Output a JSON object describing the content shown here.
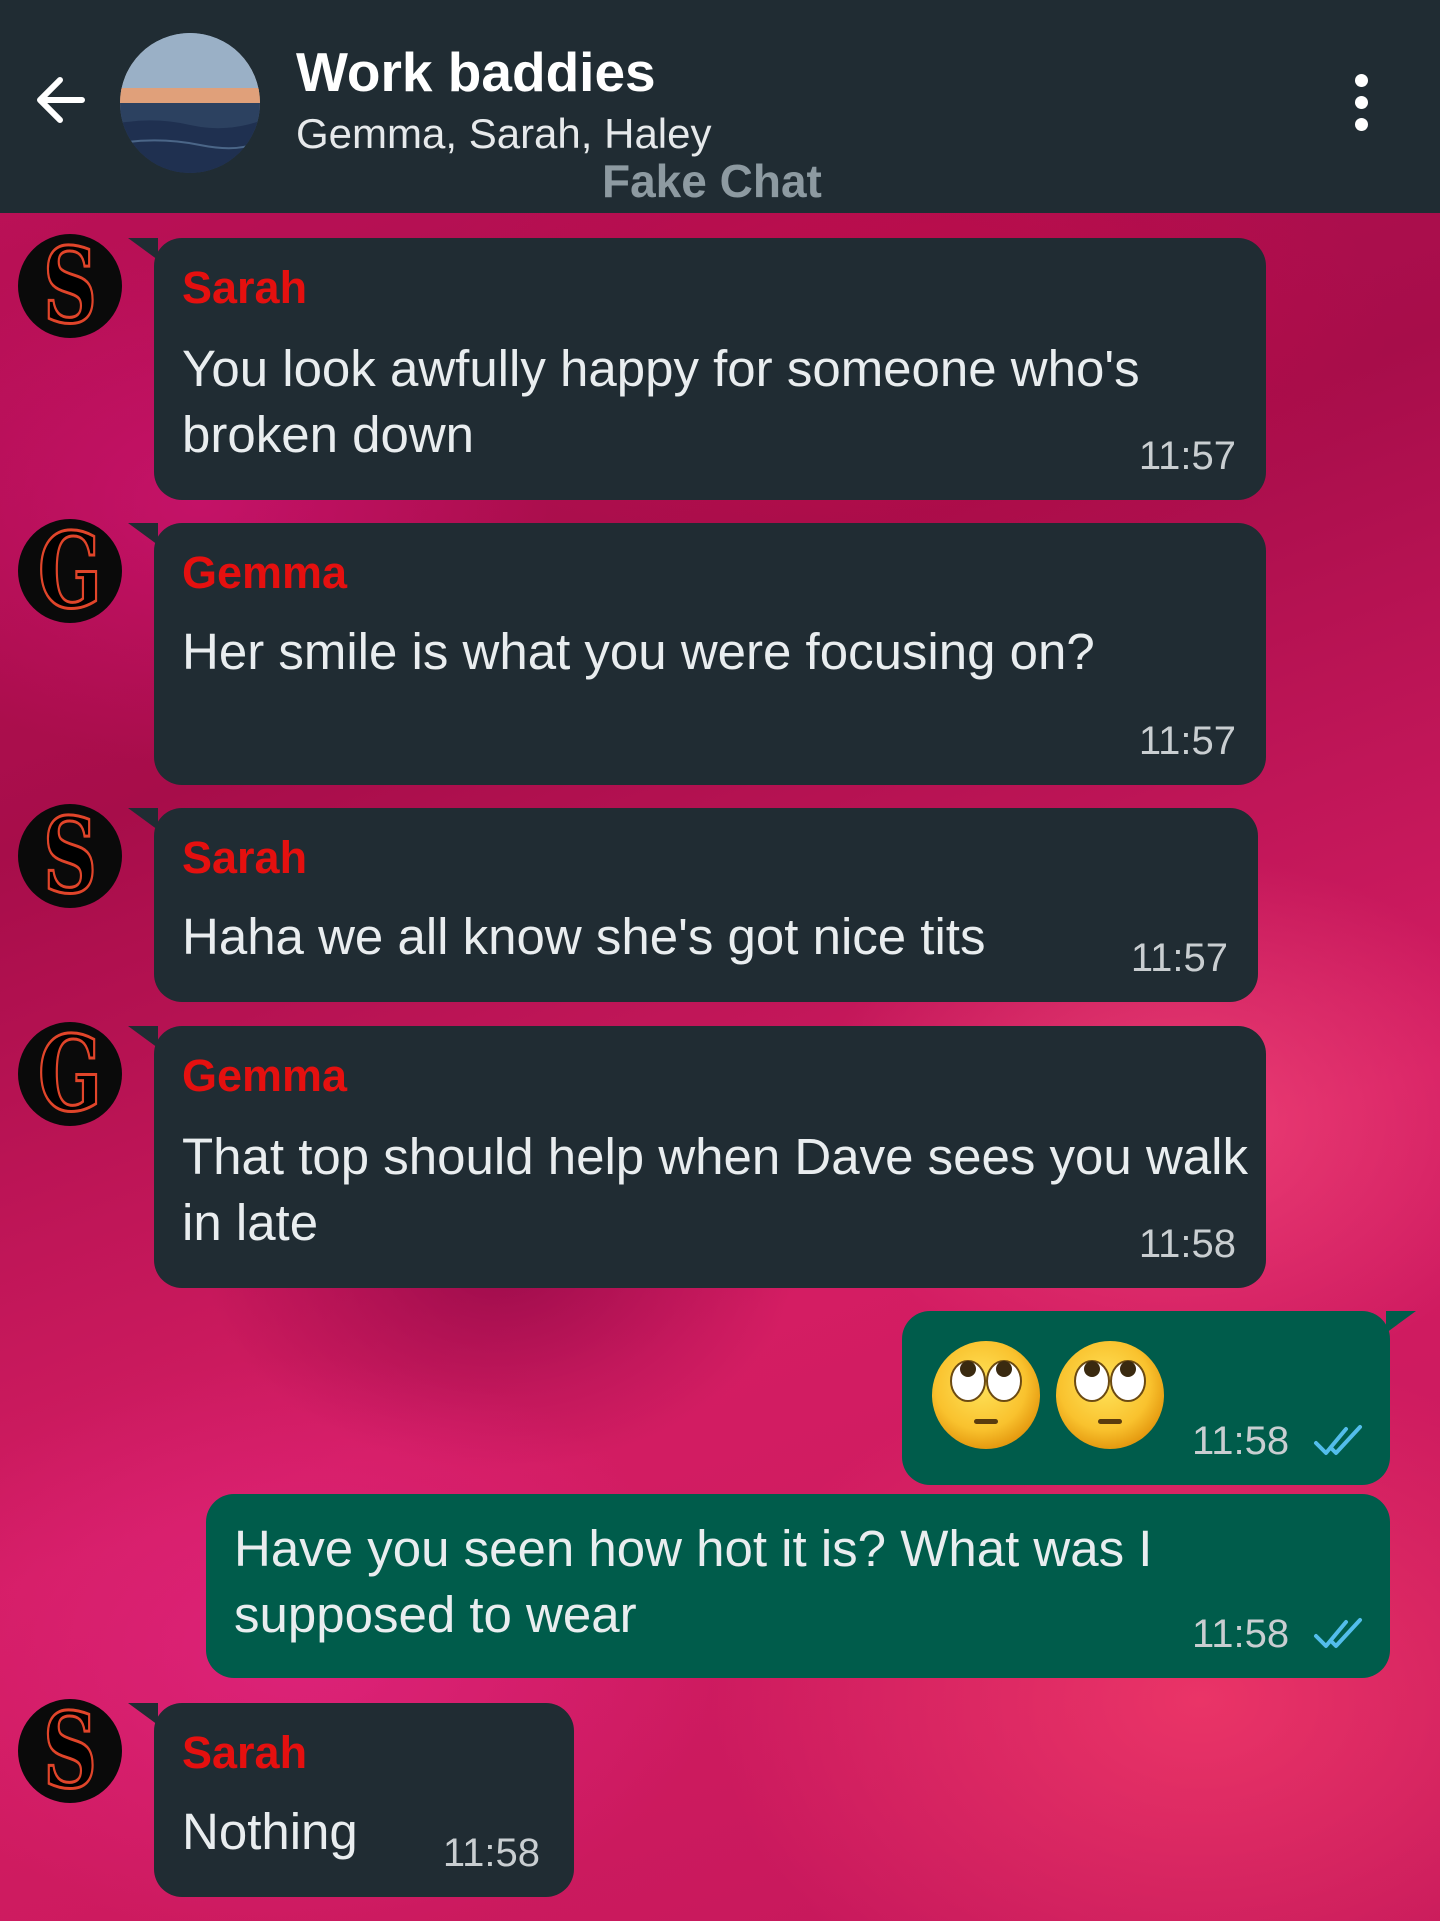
{
  "header": {
    "title": "Work baddies",
    "subtitle": "Gemma, Sarah, Haley",
    "watermark": "Fake Chat"
  },
  "messages": [
    {
      "sender": "Sarah",
      "avatar_letter": "S",
      "text": "You look awfully happy for someone who's broken down",
      "time": "11:57"
    },
    {
      "sender": "Gemma",
      "avatar_letter": "G",
      "text": "Her smile is what you were focusing on?",
      "time": "11:57"
    },
    {
      "sender": "Sarah",
      "avatar_letter": "S",
      "text": "Haha we all know she's got nice tits",
      "time": "11:57"
    },
    {
      "sender": "Gemma",
      "avatar_letter": "G",
      "text": "That top should help when Dave sees you walk in late",
      "time": "11:58"
    },
    {
      "sender": "",
      "emoji": [
        "face-with-rolling-eyes",
        "face-with-rolling-eyes"
      ],
      "time": "11:58",
      "status": "read"
    },
    {
      "sender": "",
      "text": "Have you seen how hot it is? What was I supposed to wear",
      "time": "11:58",
      "status": "read"
    },
    {
      "sender": "Sarah",
      "avatar_letter": "S",
      "text": "Nothing",
      "time": "11:58"
    }
  ],
  "colors": {
    "header_bg": "#202c33",
    "incoming_bubble": "#202c33",
    "outgoing_bubble": "#005c4b",
    "sender_name": "#e5100f",
    "read_ticks": "#53bdeb"
  }
}
